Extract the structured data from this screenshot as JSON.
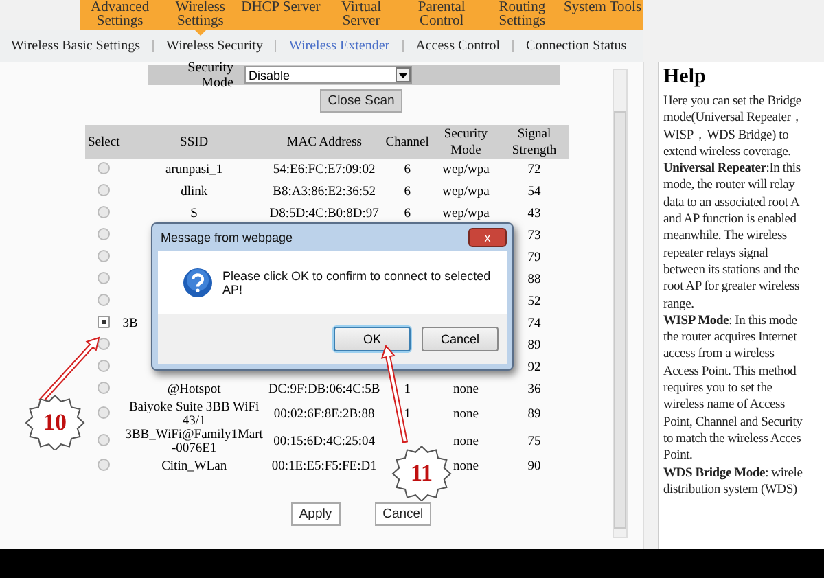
{
  "nav": [
    {
      "label": "Advanced Settings",
      "selected": false
    },
    {
      "label": "Wireless Settings",
      "selected": true
    },
    {
      "label": "DHCP Server",
      "selected": false
    },
    {
      "label": "Virtual Server",
      "selected": false
    },
    {
      "label": "Parental Control",
      "selected": false
    },
    {
      "label": "Routing Settings",
      "selected": false
    },
    {
      "label": "System Tools",
      "selected": false
    }
  ],
  "subtabs": [
    {
      "label": "Wireless Basic Settings",
      "selected": false
    },
    {
      "label": "Wireless Security",
      "selected": false
    },
    {
      "label": "Wireless Extender",
      "selected": true
    },
    {
      "label": "Access Control",
      "selected": false
    },
    {
      "label": "Connection Status",
      "selected": false
    }
  ],
  "security_mode": {
    "label": "Security Mode",
    "value": "Disable"
  },
  "close_scan": "Close Scan",
  "table": {
    "columns": [
      "Select",
      "SSID",
      "MAC Address",
      "Channel",
      "Security Mode",
      "Signal Strength"
    ],
    "rows": [
      {
        "selected": false,
        "ssid": "arunpasi_1",
        "mac": "54:E6:FC:E7:09:02",
        "channel": "6",
        "security": "wep/wpa",
        "signal": "72"
      },
      {
        "selected": false,
        "ssid": "dlink",
        "mac": "B8:A3:86:E2:36:52",
        "channel": "6",
        "security": "wep/wpa",
        "signal": "54"
      },
      {
        "selected": false,
        "ssid": "S",
        "mac": "D8:5D:4C:B0:8D:97",
        "channel": "6",
        "security": "wep/wpa",
        "signal": "43"
      },
      {
        "selected": false,
        "signal": "73"
      },
      {
        "selected": false,
        "signal": "79"
      },
      {
        "selected": false,
        "signal": "88"
      },
      {
        "selected": false,
        "signal": "52"
      },
      {
        "selected": true,
        "ssid": "3B",
        "signal": "74"
      },
      {
        "selected": false,
        "signal": "89"
      },
      {
        "selected": false,
        "signal": "92"
      },
      {
        "selected": false,
        "ssid": "@Hotspot",
        "mac": "DC:9F:DB:06:4C:5B",
        "channel": "1",
        "security": "none",
        "signal": "36"
      },
      {
        "selected": false,
        "ssid": "Baiyoke Suite 3BB WiFi 43/1",
        "mac": "00:02:6F:8E:2B:88",
        "channel": "1",
        "security": "none",
        "signal": "89"
      },
      {
        "selected": false,
        "ssid": "3BB_WiFi@Family1Mart -0076E1",
        "mac": "00:15:6D:4C:25:04",
        "security": "none",
        "signal": "75"
      },
      {
        "selected": false,
        "ssid": "Citin_WLan",
        "mac": "00:1E:E5:F5:FE:D1",
        "security": "none",
        "signal": "90"
      }
    ]
  },
  "buttons": [
    "Apply",
    "Cancel"
  ],
  "dialog": {
    "title": "Message from webpage",
    "close": "x",
    "message": "Please click OK to confirm to connect to selected AP!",
    "buttons": [
      {
        "label": "OK",
        "focused": true
      },
      {
        "label": "Cancel",
        "focused": false
      }
    ]
  },
  "help": {
    "title": "Help",
    "lines": [
      "Here you can set the Bridge",
      "mode(Universal Repeater，",
      "WISP，WDS Bridge) to",
      "extend wireless coverage.",
      "**Universal Repeater**:In this",
      "mode, the router will relay",
      "data to an associated root A",
      "and AP function is enabled",
      "meanwhile. The wireless",
      "repeater relays signal",
      "between its stations and the",
      "root AP for greater wireless",
      "range.",
      "**WISP Mode**: In this mode",
      "the router acquires Internet",
      "access from a wireless",
      "Access Point. This method",
      "requires you to set the",
      "wireless name of Access",
      "Point, Channel and Security",
      "to match the wireless Acces",
      "Point.",
      "**WDS Bridge Mode**: wirele",
      "distribution system (WDS)"
    ]
  },
  "annotations": [
    {
      "label": "10"
    },
    {
      "label": "11"
    }
  ]
}
